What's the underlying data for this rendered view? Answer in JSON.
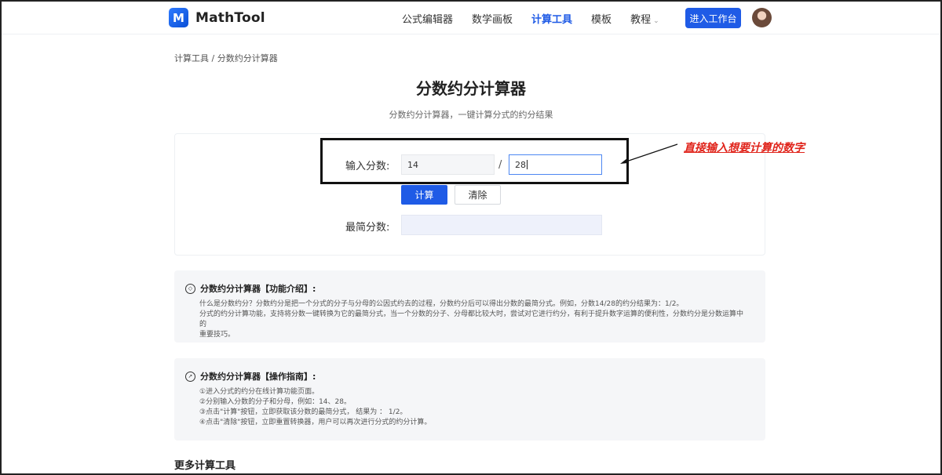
{
  "header": {
    "logo_letter": "M",
    "logo_text": "MathTool",
    "nav": [
      {
        "label": "公式编辑器",
        "active": false
      },
      {
        "label": "数学画板",
        "active": false
      },
      {
        "label": "计算工具",
        "active": true
      },
      {
        "label": "模板",
        "active": false
      },
      {
        "label": "教程",
        "active": false,
        "has_dropdown": true
      }
    ],
    "workspace_button": "进入工作台",
    "caret": "⌄"
  },
  "breadcrumb": "计算工具 / 分数约分计算器",
  "page_title": "分数约分计算器",
  "subtitle": "分数约分计算器，一键计算分式的约分结果",
  "calculator": {
    "input_label": "输入分数:",
    "numerator": "14",
    "slash": "/",
    "denominator": "28",
    "calc_button": "计算",
    "clear_button": "清除",
    "result_label": "最简分数:",
    "result_value": ""
  },
  "annotation": {
    "text": "直接输入想要计算的数字",
    "color": "#e0241b"
  },
  "intro": {
    "icon": "cube-icon",
    "title": "分数约分计算器【功能介绍】:",
    "lines": [
      "什么是分数约分？分数约分是把一个分式的分子与分母的公因式约去的过程，分数约分后可以得出分数的最简分式。例如，分数14/28的约分结果为：1/2。",
      "分式的约分计算功能，支持将分数一键转换为它的最简分式，当一个分数的分子、分母都比较大时，尝试对它进行约分，有利于提升数字运算的便利性，分数约分是分数运算中的",
      "重要技巧。"
    ]
  },
  "guide": {
    "icon": "compass-icon",
    "title": "分数约分计算器【操作指南】:",
    "lines": [
      "①进入分式的约分在线计算功能页面。",
      "②分别输入分数的分子和分母，例如：14、28。",
      "③点击\"计算\"按钮，立即获取该分数的最简分式， 结果为 ： 1/2。",
      "④点击\"清除\"按钮，立即重置转换器，用户可以再次进行分式的约分计算。"
    ]
  },
  "more_tools_title": "更多计算工具",
  "colors": {
    "primary": "#1f5be6",
    "annotation": "#e0241b"
  }
}
